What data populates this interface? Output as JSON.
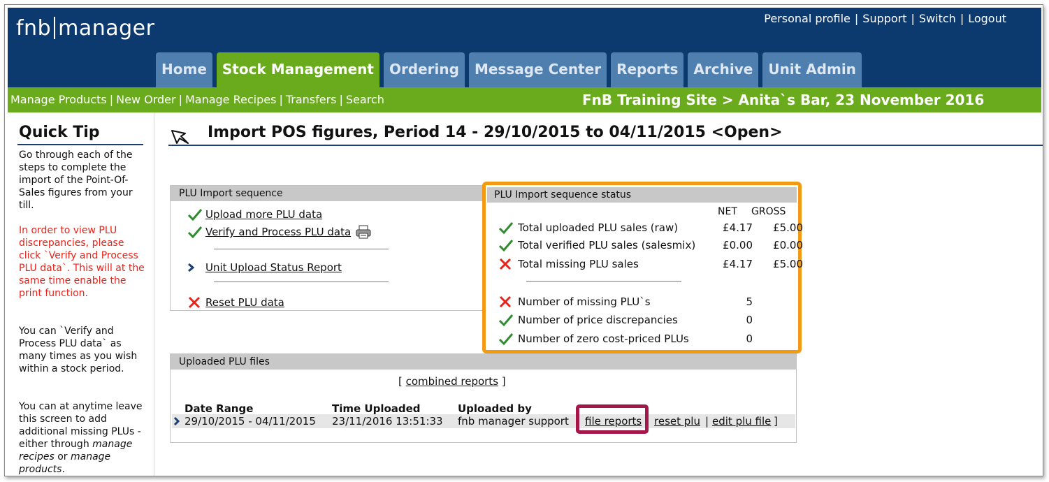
{
  "header": {
    "logo_left": "fnb",
    "logo_right": "manager",
    "links": [
      "Personal profile",
      "Support",
      "Switch",
      "Logout"
    ]
  },
  "tabs": [
    {
      "label": "Home",
      "active": false
    },
    {
      "label": "Stock Management",
      "active": true
    },
    {
      "label": "Ordering",
      "active": false
    },
    {
      "label": "Message Center",
      "active": false
    },
    {
      "label": "Reports",
      "active": false
    },
    {
      "label": "Archive",
      "active": false
    },
    {
      "label": "Unit Admin",
      "active": false
    }
  ],
  "subnav": {
    "links": [
      "Manage Products",
      "New Order",
      "Manage Recipes",
      "Transfers",
      "Search"
    ],
    "location": "FnB Training Site > Anita`s Bar,  23 November 2016"
  },
  "sidebar": {
    "title": "Quick Tip",
    "p1": "Go through each of the steps to complete the import of the Point-Of-Sales figures from your till.",
    "p2": "In order to view PLU discrepancies, please click `Verify and Process PLU data`. This will at the same time enable the print function.",
    "p3": "You can `Verify and Process PLU data` as many times as you wish within a stock period.",
    "p4_a": "You can at anytime leave this screen to add additional missing PLUs - either through ",
    "p4_b": "manage recipes",
    "p4_c": " or ",
    "p4_d": "manage products",
    "p4_e": "."
  },
  "page": {
    "title": "Import POS figures, Period 14 - 29/10/2015 to 04/11/2015 <Open>"
  },
  "sequence": {
    "heading": "PLU Import sequence",
    "upload": "Upload more PLU data",
    "verify": "Verify and Process PLU data",
    "unit_report": "Unit Upload Status Report",
    "reset": "Reset PLU data"
  },
  "status": {
    "heading": "PLU Import sequence status",
    "col_net": "NET",
    "col_gross": "GROSS",
    "rows": [
      {
        "label": "Total uploaded PLU sales (raw)",
        "net": "£4.17",
        "gross": "£5.00",
        "ok": true
      },
      {
        "label": "Total verified PLU sales (salesmix)",
        "net": "£0.00",
        "gross": "£0.00",
        "ok": true
      },
      {
        "label": "Total missing PLU sales",
        "net": "£4.17",
        "gross": "£5.00",
        "ok": false
      }
    ],
    "counts": [
      {
        "label": "Number of missing PLU`s",
        "value": "5",
        "ok": false
      },
      {
        "label": "Number of price discrepancies",
        "value": "0",
        "ok": true
      },
      {
        "label": "Number of zero cost-priced PLUs",
        "value": "0",
        "ok": true
      }
    ]
  },
  "files": {
    "heading": "Uploaded PLU files",
    "combined_open": "[ ",
    "combined": "combined reports",
    "combined_close": " ]",
    "col_date": "Date Range",
    "col_time": "Time Uploaded",
    "col_by": "Uploaded by",
    "row": {
      "date": "29/10/2015 - 04/11/2015",
      "time": "23/11/2016 13:51:33",
      "by": "fnb manager support",
      "file_reports": "file reports",
      "reset_plu": "reset plu",
      "edit": "edit plu file",
      "pipe": "|",
      "close": "]"
    }
  },
  "colors": {
    "navy": "#0d3a6e",
    "green": "#6aab1e",
    "tab_blue": "#4f7fae",
    "highlight_orange": "#f39a14",
    "highlight_crimson": "#a3174b",
    "check_green": "#2e8b2e",
    "cross_red": "#e8231a"
  }
}
